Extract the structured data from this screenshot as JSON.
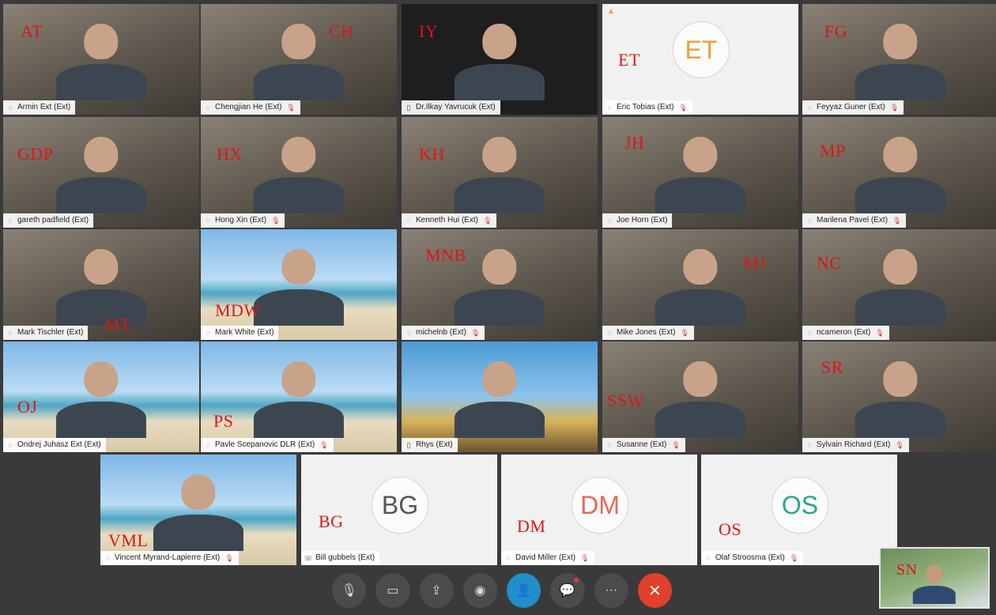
{
  "participants": [
    {
      "initials": "AT",
      "name": "Armin Ext (Ext)",
      "device": "audio",
      "muted": false,
      "video": true,
      "bg": "video"
    },
    {
      "initials": "CH",
      "name": "Chengjian He (Ext)",
      "device": "audio",
      "muted": true,
      "video": true,
      "bg": "video"
    },
    {
      "initials": "IY",
      "name": "Dr.Ilkay Yavrucuk (Ext)",
      "device": "phone",
      "muted": false,
      "video": true,
      "bg": "dark"
    },
    {
      "initials": "ET",
      "name": "Eric Tobias (Ext)",
      "device": "audio",
      "muted": true,
      "video": false,
      "avatar": "ET",
      "avatar_color": "#e8a33a",
      "warning": true
    },
    {
      "initials": "FG",
      "name": "Feyyaz Guner (Ext)",
      "device": "audio",
      "muted": true,
      "video": true,
      "bg": "video"
    },
    {
      "initials": "GDP",
      "name": "gareth padfield (Ext)",
      "device": "audio",
      "muted": false,
      "video": true,
      "bg": "video"
    },
    {
      "initials": "HX",
      "name": "Hong Xin (Ext)",
      "device": "audio",
      "muted": true,
      "video": true,
      "bg": "video"
    },
    {
      "initials": "KH",
      "name": "Kenneth Hui (Ext)",
      "device": "audio",
      "muted": true,
      "video": true,
      "bg": "video"
    },
    {
      "initials": "JH",
      "name": "Joe Horn (Ext)",
      "device": "audio",
      "muted": false,
      "video": true,
      "bg": "video"
    },
    {
      "initials": "MP",
      "name": "Marilena Pavel (Ext)",
      "device": "audio",
      "muted": true,
      "video": true,
      "bg": "video"
    },
    {
      "initials": "MT",
      "name": "Mark Tischler (Ext)",
      "device": "audio",
      "muted": false,
      "video": true,
      "bg": "video"
    },
    {
      "initials": "MDW",
      "name": "Mark White (Ext)",
      "device": "audio",
      "muted": false,
      "video": true,
      "bg": "beach"
    },
    {
      "initials": "MNB",
      "name": "michelnb (Ext)",
      "device": "audio",
      "muted": true,
      "video": true,
      "bg": "video"
    },
    {
      "initials": "MJ",
      "name": "Mike Jones (Ext)",
      "device": "audio",
      "muted": true,
      "video": true,
      "bg": "video"
    },
    {
      "initials": "NC",
      "name": "ncameron (Ext)",
      "device": "audio",
      "muted": true,
      "video": true,
      "bg": "video"
    },
    {
      "initials": "OJ",
      "name": "Ondrej Juhasz Ext (Ext)",
      "device": "audio",
      "muted": false,
      "video": true,
      "bg": "beach"
    },
    {
      "initials": "PS",
      "name": "Pavle Scepanovic DLR (Ext)",
      "device": "audio",
      "muted": true,
      "video": true,
      "bg": "beach"
    },
    {
      "initials": "",
      "name": "Rhys (Ext)",
      "device": "phone",
      "muted": false,
      "video": true,
      "bg": "surf"
    },
    {
      "initials": "SSW",
      "name": "Susanne (Ext)",
      "device": "audio",
      "muted": true,
      "video": true,
      "bg": "video"
    },
    {
      "initials": "SR",
      "name": "Sylvain Richard (Ext)",
      "device": "audio",
      "muted": true,
      "video": true,
      "bg": "video"
    },
    {
      "initials": "VML",
      "name": "Vincent Myrand-Lapierre (Ext)",
      "device": "audio",
      "muted": true,
      "video": true,
      "bg": "beach"
    },
    {
      "initials": "BG",
      "name": "Bill gubbels (Ext)",
      "device": "call",
      "muted": false,
      "video": false,
      "avatar": "BG",
      "avatar_color": "#555555"
    },
    {
      "initials": "DM",
      "name": "David Miller (Ext)",
      "device": "audio",
      "muted": true,
      "video": false,
      "avatar": "DM",
      "avatar_color": "#e06a55"
    },
    {
      "initials": "OS",
      "name": "Olaf Stroosma (Ext)",
      "device": "audio",
      "muted": true,
      "video": false,
      "avatar": "OS",
      "avatar_color": "#2aa882"
    }
  ],
  "self_view": {
    "initials": "SN"
  },
  "controls": [
    {
      "id": "mute",
      "icon": "microphone-muted-icon",
      "glyph": "🎙"
    },
    {
      "id": "video",
      "icon": "camera-off-icon",
      "glyph": "▭"
    },
    {
      "id": "share",
      "icon": "share-icon",
      "glyph": "⇪"
    },
    {
      "id": "record",
      "icon": "record-icon",
      "glyph": "◉"
    },
    {
      "id": "participants",
      "icon": "participants-icon",
      "glyph": "👤",
      "active": true
    },
    {
      "id": "chat",
      "icon": "chat-icon",
      "glyph": "💬",
      "badge": true
    },
    {
      "id": "more",
      "icon": "more-icon",
      "glyph": "···"
    },
    {
      "id": "end",
      "icon": "end-call-icon",
      "glyph": "✕",
      "end": true
    }
  ]
}
